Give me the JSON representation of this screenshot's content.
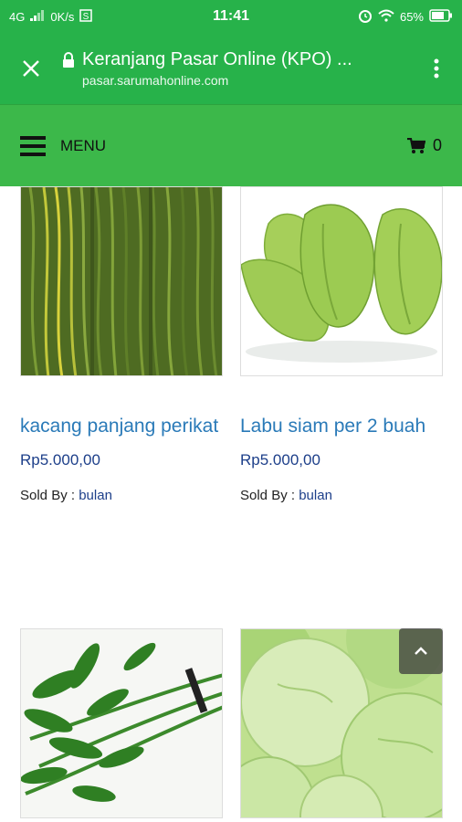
{
  "status": {
    "network": "4G",
    "speed": "0K/s",
    "time": "11:41",
    "battery": "65%"
  },
  "browser": {
    "title": "Keranjang Pasar Online (KPO) ...",
    "domain": "pasar.sarumahonline.com"
  },
  "nav": {
    "menu_label": "MENU",
    "cart_count": "0"
  },
  "products": [
    {
      "name": "kacang panjang perikat",
      "price": "Rp5.000,00",
      "sold_by": "Sold By :",
      "vendor": "bulan"
    },
    {
      "name": "Labu siam per 2 buah",
      "price": "Rp5.000,00",
      "sold_by": "Sold By :",
      "vendor": "bulan"
    },
    {
      "name": "",
      "price": "",
      "sold_by": "",
      "vendor": ""
    },
    {
      "name": "",
      "price": "",
      "sold_by": "",
      "vendor": ""
    }
  ],
  "colors": {
    "header_green": "#27b24a",
    "nav_green": "#3cb84a",
    "link_blue": "#2a7ab8",
    "price_blue": "#1d3f8a"
  }
}
